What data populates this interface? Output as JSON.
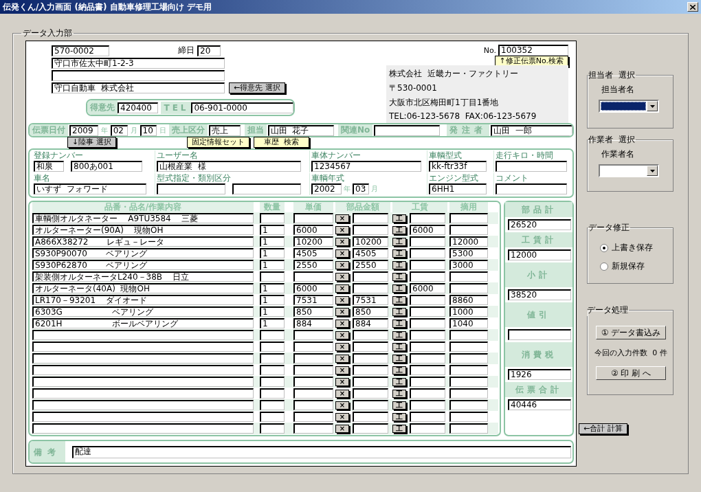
{
  "window": {
    "title": "伝発くん/入力画面 (納品書) 自動車修理工場向け デモ用"
  },
  "group_title": "データ入力部",
  "customer": {
    "postal": "570-0002",
    "closing_label": "締日",
    "closing_day": "20",
    "address": "守口市佐太中町1-2-3",
    "name": "守口自動車  株式会社",
    "select_button": "←得意先 選択",
    "code_label": "得意先",
    "code": "420400",
    "tel_label": "TEL",
    "tel": "06-901-0000"
  },
  "slip": {
    "no_label": "No.",
    "no": "100352",
    "search_button": "↑修正伝票No.検索"
  },
  "company": [
    "株式会社  近畿カー・ファクトリー",
    "〒530-0001",
    "大阪市北区梅田町1丁目1番地",
    "TEL:06-123-5678  FAX:06-123-5679"
  ],
  "header_row": {
    "date_label": "伝票日付",
    "year": "2009",
    "year_unit": "年",
    "month": "02",
    "month_unit": "月",
    "day": "10",
    "day_unit": "日",
    "sales_label": "売上区分",
    "sales": "売上",
    "staff_label": "担当",
    "staff": "山田  花子",
    "related_label": "関連No",
    "orderer_label": "発注者",
    "orderer": "山田  一郎"
  },
  "action_buttons": [
    {
      "label": "↓陸事 選択",
      "kind": "gray"
    },
    {
      "label": "固定情報セット",
      "kind": "yellow"
    },
    {
      "label": "車歴  検索",
      "kind": "yellow"
    }
  ],
  "vehicle": [
    [
      {
        "label": "登録ナンバー",
        "inputs": [
          {
            "value": "和泉"
          },
          {
            "value": "800あ001"
          }
        ]
      },
      {
        "label": "ユーザー名",
        "inputs": [
          {
            "value": "山根産業  様"
          }
        ]
      },
      {
        "label": "車体ナンバー",
        "inputs": [
          {
            "value": "1234567"
          }
        ]
      },
      {
        "label": "車輌型式",
        "inputs": [
          {
            "value": "kk-ftr33f"
          }
        ]
      },
      {
        "label": "走行キロ・時間"
      }
    ],
    [
      {
        "label": "車名",
        "inputs": [
          {
            "value": "いすず  フォワード"
          }
        ]
      },
      {
        "label": "型式指定・類別区分"
      },
      {
        "label": "車輌年式",
        "inputs": [
          {
            "value": "2002",
            "unit": "年"
          },
          {
            "value": "03",
            "unit": "月"
          }
        ]
      },
      {
        "label": "エンジン型式",
        "inputs": [
          {
            "value": "6HH1"
          }
        ]
      },
      {
        "label": "コメント"
      }
    ]
  ],
  "items": {
    "columns": [
      "品番・品名/作業内容",
      "数量",
      "単価",
      "部品金額",
      "工賃",
      "摘用"
    ],
    "rows": [
      {
        "name": "車輌側オルタネーター    A9TU3584    三菱",
        "parts_button": "×",
        "labor_button": "工"
      },
      {
        "name": "オルターネーター(90A)    現物OH",
        "qty": "1",
        "price": "6000",
        "parts_button": "×",
        "labor_button": "工",
        "labor": "6000"
      },
      {
        "name": "A866X38272       レギュ－レータ",
        "qty": "1",
        "price": "10200",
        "parts_button": "×",
        "parts": "10200",
        "labor_button": "工",
        "note": "12000"
      },
      {
        "name": "S930P90070       ベアリング",
        "qty": "1",
        "price": "4505",
        "parts_button": "×",
        "parts": "4505",
        "labor_button": "工",
        "note": "5300"
      },
      {
        "name": "S930P62870       ベアリング",
        "qty": "1",
        "price": "2550",
        "parts_button": "×",
        "parts": "2550",
        "labor_button": "工",
        "note": "3000"
      },
      {
        "name": "架装側オルターネータL240－38B    日立",
        "parts_button": "×",
        "labor_button": "工"
      },
      {
        "name": "オルターネータ(40A)  現物OH",
        "qty": "1",
        "price": "6000",
        "parts_button": "×",
        "labor_button": "工",
        "labor": "6000"
      },
      {
        "name": "LR170－93201    ダイオード",
        "qty": "1",
        "price": "7531",
        "parts_button": "×",
        "parts": "7531",
        "labor_button": "工",
        "note": "8860"
      },
      {
        "name": "6303G                   ベアリング",
        "qty": "1",
        "price": "850",
        "parts_button": "×",
        "parts": "850",
        "labor_button": "工",
        "note": "1000"
      },
      {
        "name": "6201H                   ボールベアリング",
        "qty": "1",
        "price": "884",
        "parts_button": "×",
        "parts": "884",
        "labor_button": "工",
        "note": "1040"
      },
      {
        "parts_button": "×",
        "labor_button": "工"
      },
      {
        "parts_button": "×",
        "labor_button": "工"
      },
      {
        "parts_button": "×",
        "labor_button": "工"
      },
      {
        "parts_button": "×",
        "labor_button": "工"
      },
      {
        "parts_button": "×",
        "labor_button": "工"
      },
      {
        "parts_button": "×",
        "labor_button": "工"
      },
      {
        "parts_button": "×",
        "labor_button": "工"
      },
      {
        "parts_button": "×",
        "labor_button": "工"
      },
      {
        "parts_button": "×",
        "labor_button": "工"
      }
    ]
  },
  "totals": [
    {
      "label": "部品計",
      "value": "26520"
    },
    {
      "label": "工賃計",
      "value": "12000"
    },
    {
      "label": "小計",
      "value": "38520"
    },
    {
      "label": "値引"
    },
    {
      "label": "消費税",
      "value": "1926"
    },
    {
      "label": "伝票合計",
      "value": "40446"
    }
  ],
  "calc_button": "←合計 計算",
  "remarks": {
    "label": "備考",
    "value": "配達"
  },
  "selectors": [
    {
      "title": "担当者  選択",
      "label": "担当者名",
      "highlighted": true
    },
    {
      "title": "作業者  選択",
      "label": "作業者名",
      "highlighted": false
    }
  ],
  "correction": {
    "title": "データ修正",
    "options": [
      {
        "label": "上書き保存",
        "selected": true
      },
      {
        "label": "新規保存",
        "selected": false
      }
    ]
  },
  "processing": {
    "title": "データ処理",
    "write_button": "① データ書込み",
    "count_text": "今回の入力件数  0 件",
    "print_button": "② 印 刷 へ"
  }
}
